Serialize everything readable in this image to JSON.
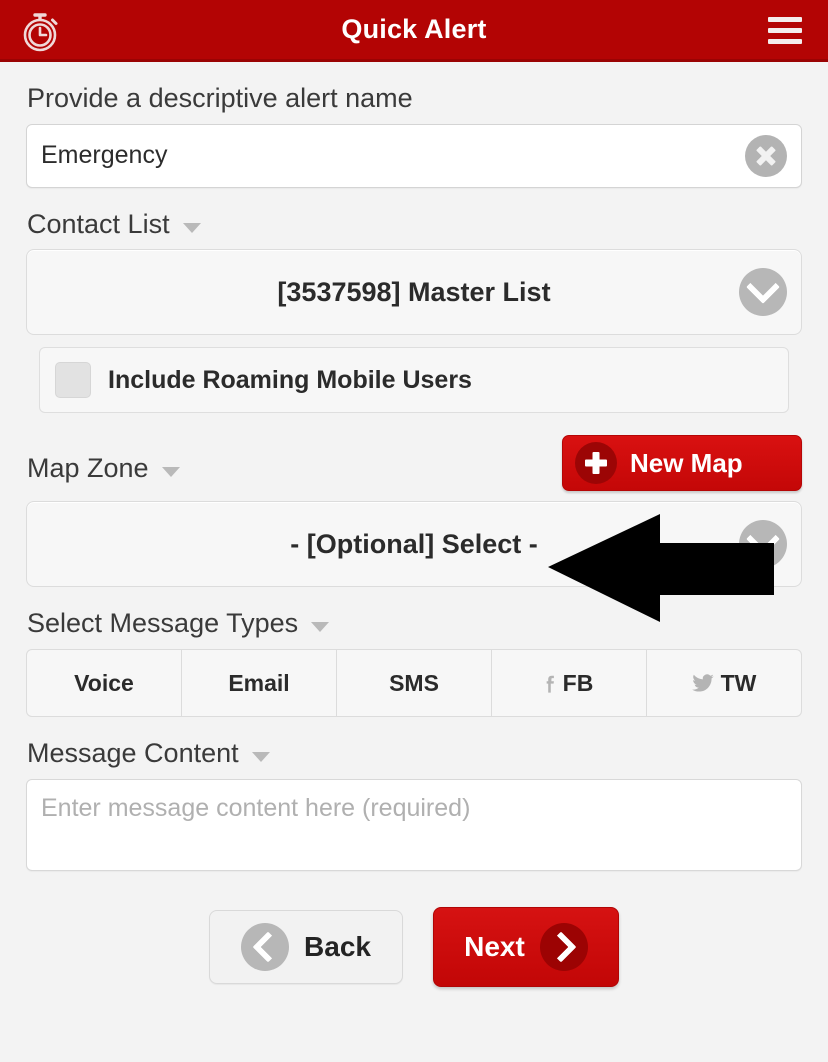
{
  "header": {
    "title": "Quick Alert",
    "logo_icon": "stopwatch-icon",
    "menu_icon": "hamburger-menu-icon",
    "background_color": "#b30404"
  },
  "form": {
    "alert_name": {
      "label": "Provide a descriptive alert name",
      "value": "Emergency",
      "placeholder": "Provide a descriptive alert name",
      "clear_icon": "clear-circle-x-icon"
    },
    "contact_list": {
      "label": "Contact List",
      "selected": "[3537598] Master List",
      "dropdown_icon": "chevron-down-circle-icon",
      "roaming": {
        "label": "Include Roaming Mobile Users",
        "checked": false
      }
    },
    "map_zone": {
      "label": "Map Zone",
      "selected": "- [Optional] Select -",
      "dropdown_icon": "chevron-down-circle-icon",
      "new_map_button": {
        "label": "New Map",
        "icon": "plus-circle-icon",
        "color": "#c40707"
      }
    },
    "message_types": {
      "label": "Select Message Types",
      "tabs": [
        {
          "label": "Voice",
          "icon": ""
        },
        {
          "label": "Email",
          "icon": ""
        },
        {
          "label": "SMS",
          "icon": ""
        },
        {
          "label": "FB",
          "icon": "facebook-icon"
        },
        {
          "label": "TW",
          "icon": "twitter-icon"
        }
      ]
    },
    "message_content": {
      "label": "Message Content",
      "value": "",
      "placeholder": "Enter message content here (required)"
    }
  },
  "footer": {
    "back": {
      "label": "Back",
      "icon": "chevron-left-circle-icon"
    },
    "next": {
      "label": "Next",
      "icon": "chevron-right-circle-icon",
      "color": "#c20606"
    }
  },
  "annotation": {
    "arrow_icon": "left-pointing-arrow-annotation",
    "color": "#000000"
  }
}
